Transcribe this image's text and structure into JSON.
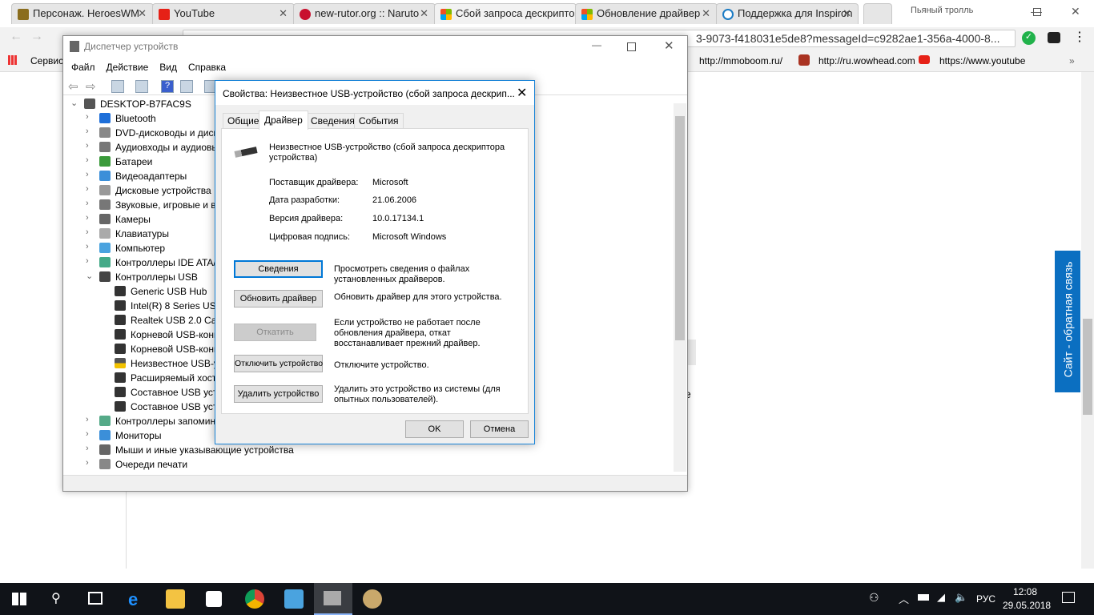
{
  "browser": {
    "tabs": [
      {
        "title": "Персонаж. HeroesWM",
        "color": "#8a6d1e"
      },
      {
        "title": "YouTube",
        "color": "#e62117"
      },
      {
        "title": "new-rutor.org :: Naruto",
        "color": "#c8102e"
      },
      {
        "title": "Сбой запроса дескриптора",
        "color": "#f25022",
        "active": true
      },
      {
        "title": "Обновление драйвер",
        "color": "#7fba00"
      },
      {
        "title": "Поддержка для Inspiron",
        "color": "#1a7bc4"
      }
    ],
    "profile": "Пьяный тролль",
    "url": "3-9073-f418031e5de8?messageId=c9282ae1-356a-4000-8...",
    "bookmarks": [
      "Сервисы",
      "http://mmoboom.ru/",
      "http://ru.wowhead.com",
      "https://www.youtube"
    ],
    "more": "»",
    "feedback": "Сайт - обратная связь",
    "partial_letter": "е"
  },
  "devmgr": {
    "title": "Диспетчер устройств",
    "menu": [
      "Файл",
      "Действие",
      "Вид",
      "Справка"
    ],
    "root": "DESKTOP-B7FAC9S",
    "categories": [
      "Bluetooth",
      "DVD-дисководы и диск",
      "Аудиовходы и аудиовы",
      "Батареи",
      "Видеоадаптеры",
      "Дисковые устройства",
      "Звуковые, игровые и в",
      "Камеры",
      "Клавиатуры",
      "Компьютер",
      "Контроллеры IDE ATA/",
      "Контроллеры USB"
    ],
    "usb_children": [
      "Generic USB Hub",
      "Intel(R) 8 Series USB",
      "Realtek USB 2.0 Card",
      "Корневой USB-конц",
      "Корневой USB-конц",
      "Неизвестное USB-у",
      "Расширяемый хост",
      "Составное USB устр",
      "Составное USB устр"
    ],
    "after": [
      "Контроллеры запомин",
      "Мониторы",
      "Мыши и иные указывающие устройства",
      "Очереди печати"
    ]
  },
  "dialog": {
    "title": "Свойства: Неизвестное USB-устройство (сбой запроса дескрип...",
    "tabs": [
      "Общие",
      "Драйвер",
      "Сведения",
      "События"
    ],
    "active_tab": "Драйвер",
    "device_name": "Неизвестное USB-устройство (сбой запроса дескриптора устройства)",
    "fields": [
      {
        "label": "Поставщик драйвера:",
        "value": "Microsoft"
      },
      {
        "label": "Дата разработки:",
        "value": "21.06.2006"
      },
      {
        "label": "Версия драйвера:",
        "value": "10.0.17134.1"
      },
      {
        "label": "Цифровая подпись:",
        "value": "Microsoft Windows"
      }
    ],
    "actions": [
      {
        "button": "Сведения",
        "desc": "Просмотреть сведения о файлах установленных драйверов."
      },
      {
        "button": "Обновить драйвер",
        "desc": "Обновить драйвер для этого устройства."
      },
      {
        "button": "Откатить",
        "desc": "Если устройство не работает после обновления драйвера, откат восстанавливает прежний драйвер."
      },
      {
        "button": "Отключить устройство",
        "desc": "Отключите устройство."
      },
      {
        "button": "Удалить устройство",
        "desc": "Удалить это устройство из системы (для опытных пользователей)."
      }
    ],
    "ok": "OK",
    "cancel": "Отмена"
  },
  "taskbar": {
    "lang": "РУС",
    "time": "12:08",
    "date": "29.05.2018"
  }
}
